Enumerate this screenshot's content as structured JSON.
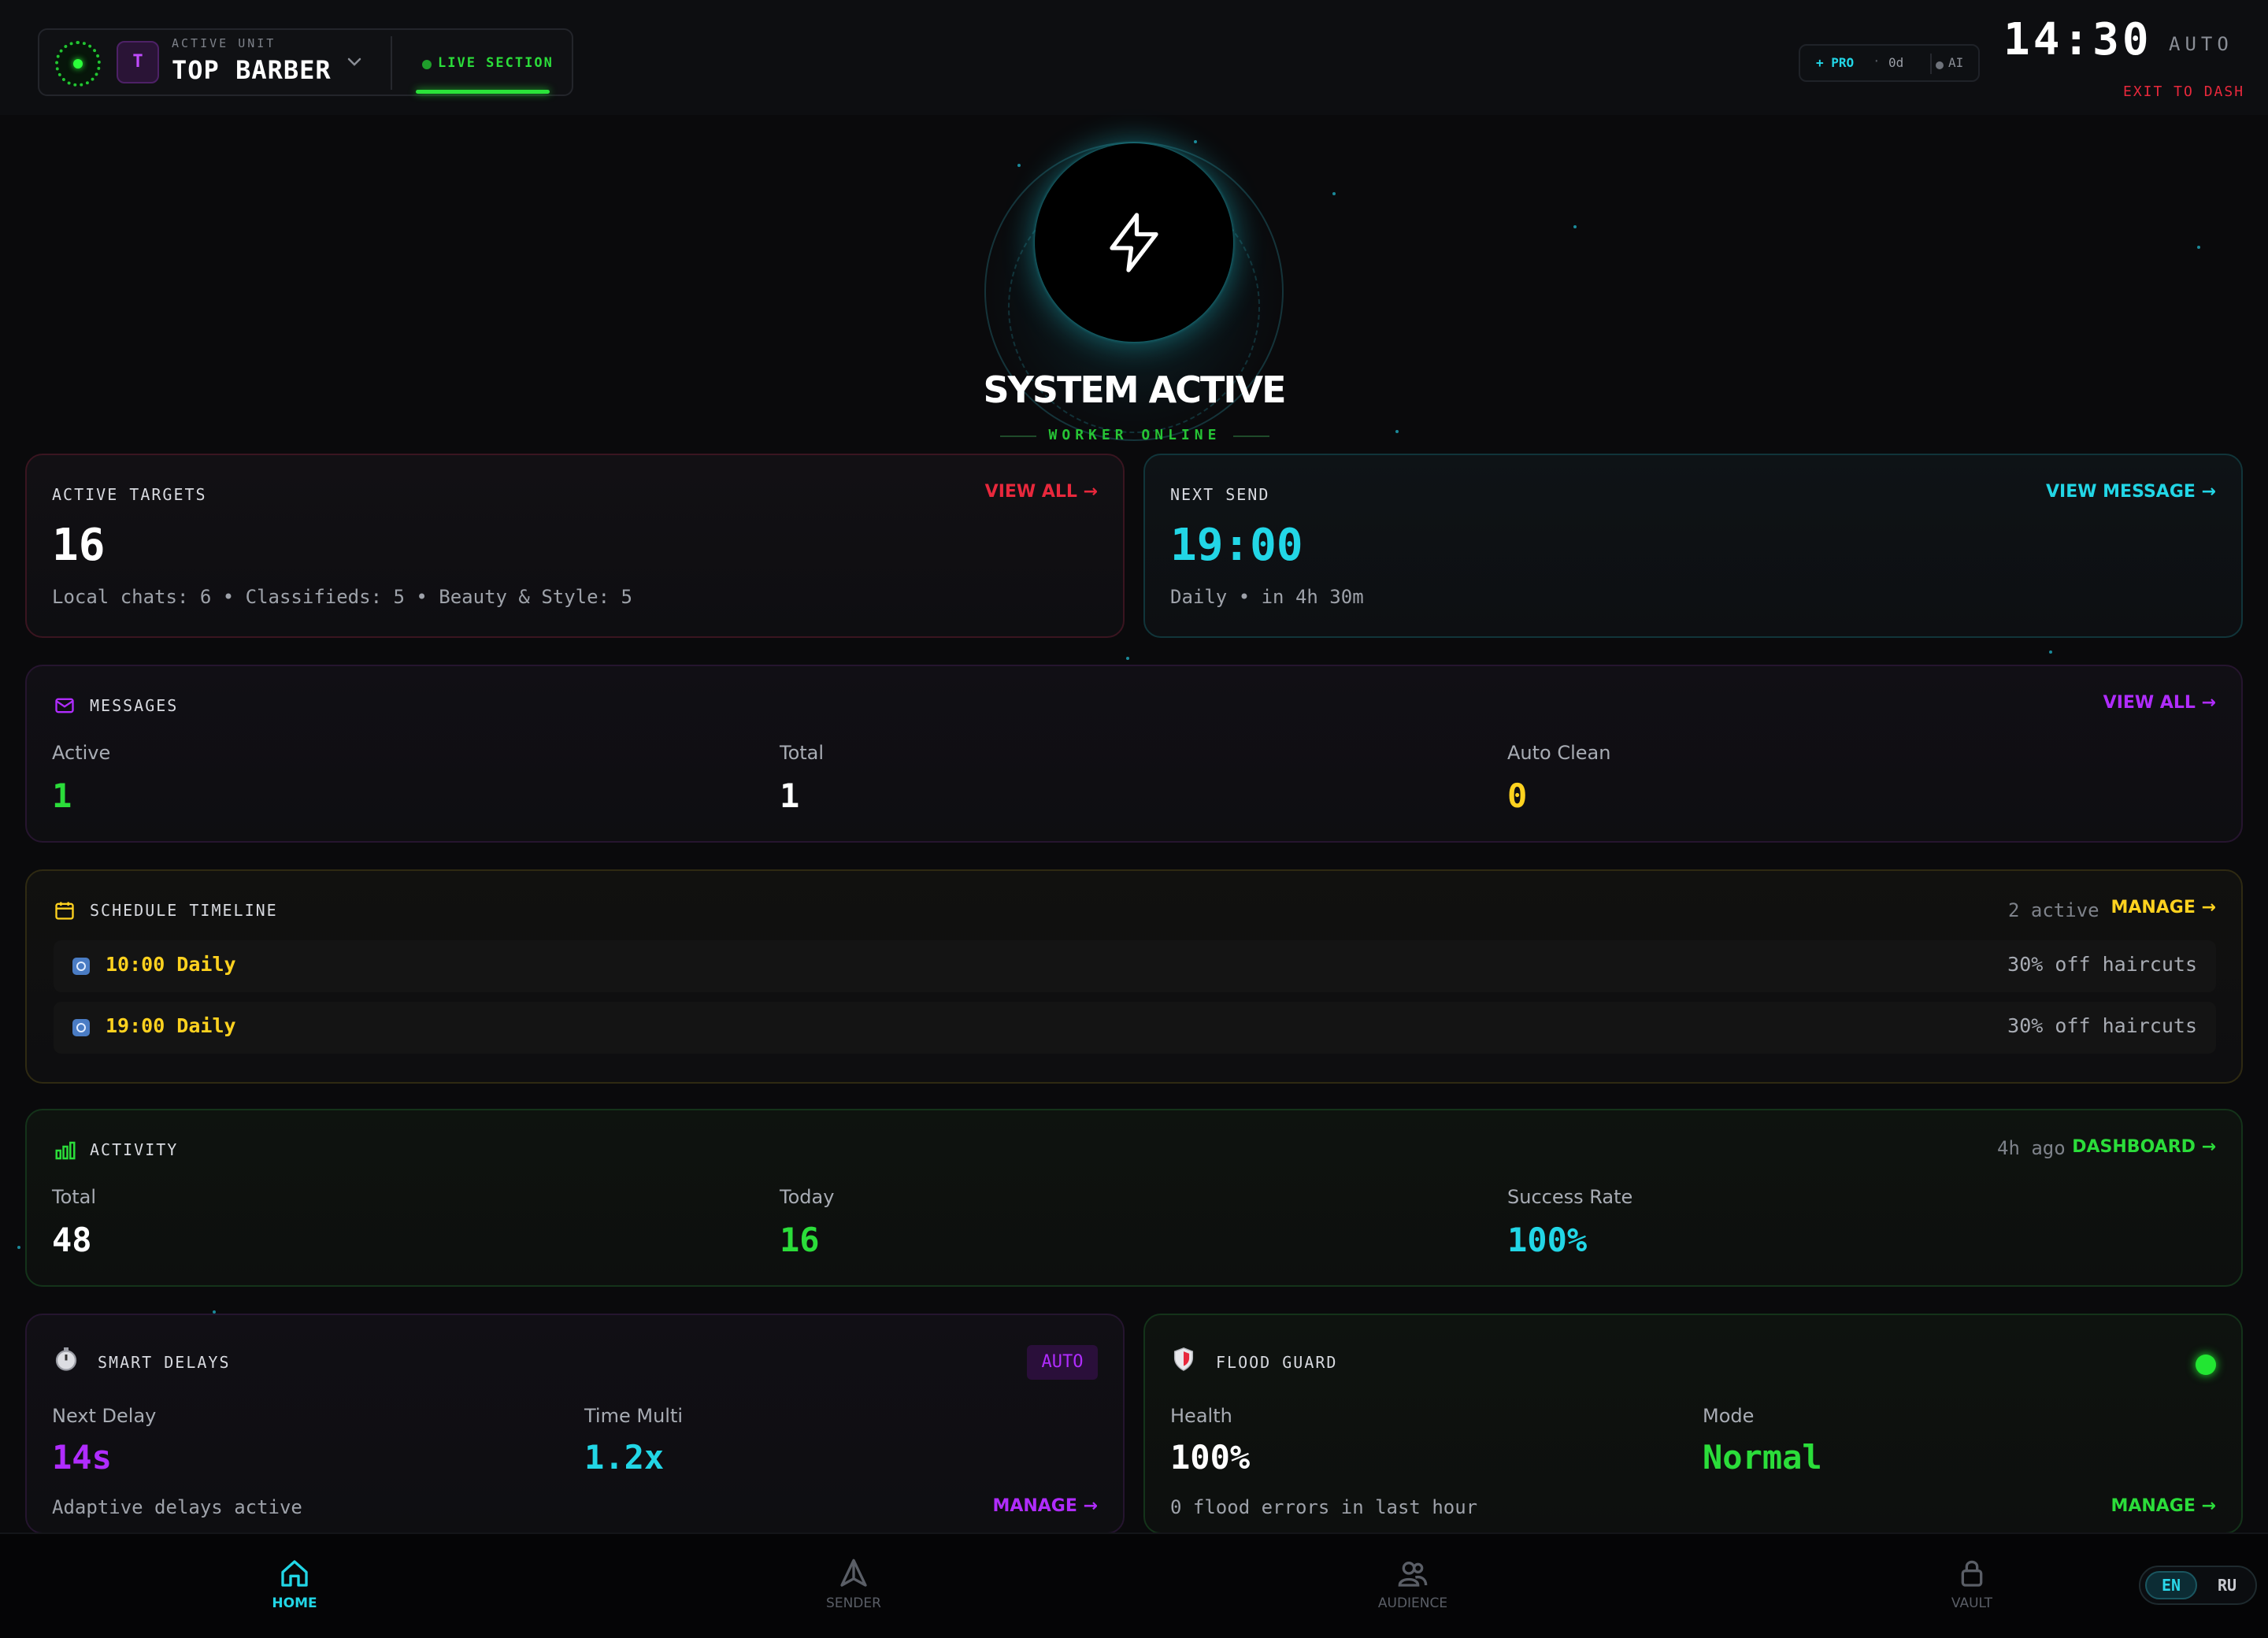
{
  "header": {
    "active_unit_label": "ACTIVE UNIT",
    "unit_avatar": "T",
    "unit_name": "TOP BARBER",
    "live_section": "LIVE SECTION",
    "plan": "+ PRO",
    "plan_sep": "·",
    "plan_days": "0d",
    "plan_ai": "AI",
    "clock": "14:30",
    "clock_mode": "AUTO",
    "exit_label": "EXIT TO DASH"
  },
  "hero": {
    "icon": "lightning-bolt-icon",
    "title": "SYSTEM ACTIVE",
    "subtitle": "WORKER ONLINE"
  },
  "targets": {
    "title": "ACTIVE TARGETS",
    "link": "VIEW ALL →",
    "value": "16",
    "breakdown": "Local chats: 6 • Classifieds: 5 • Beauty & Style: 5"
  },
  "next_send": {
    "title": "NEXT SEND",
    "link": "VIEW MESSAGE →",
    "time": "19:00",
    "detail": "Daily • in 4h 30m"
  },
  "messages": {
    "title": "MESSAGES",
    "link": "VIEW ALL →",
    "stats": [
      {
        "label": "Active",
        "value": "1"
      },
      {
        "label": "Total",
        "value": "1"
      },
      {
        "label": "Auto Clean",
        "value": "0"
      }
    ]
  },
  "schedule": {
    "title": "SCHEDULE TIMELINE",
    "count": "2 active",
    "link": "MANAGE →",
    "items": [
      {
        "time": "10:00 Daily",
        "text": "30% off haircuts"
      },
      {
        "time": "19:00 Daily",
        "text": "30% off haircuts"
      }
    ]
  },
  "activity": {
    "title": "ACTIVITY",
    "ago": "4h ago",
    "link": "DASHBOARD →",
    "stats": [
      {
        "label": "Total",
        "value": "48"
      },
      {
        "label": "Today",
        "value": "16"
      },
      {
        "label": "Success Rate",
        "value": "100%"
      }
    ]
  },
  "delays": {
    "title": "SMART DELAYS",
    "badge": "AUTO",
    "stats": [
      {
        "label": "Next Delay",
        "value": "14s"
      },
      {
        "label": "Time Multi",
        "value": "1.2x"
      }
    ],
    "note": "Adaptive delays active",
    "link": "MANAGE →"
  },
  "flood": {
    "title": "FLOOD GUARD",
    "stats": [
      {
        "label": "Health",
        "value": "100%"
      },
      {
        "label": "Mode",
        "value": "Normal"
      }
    ],
    "note": "0 flood errors in last hour",
    "link": "MANAGE →"
  },
  "nav": {
    "items": [
      {
        "label": "HOME",
        "icon": "home-icon"
      },
      {
        "label": "SENDER",
        "icon": "send-icon"
      },
      {
        "label": "AUDIENCE",
        "icon": "users-icon"
      },
      {
        "label": "VAULT",
        "icon": "lock-icon"
      }
    ],
    "lang_en": "EN",
    "lang_ru": "RU"
  },
  "colors": {
    "green": "#2bdd3a",
    "cyan": "#22d6e6",
    "red": "#e8283c",
    "purple": "#b02cff",
    "yellow": "#ffd21f"
  }
}
